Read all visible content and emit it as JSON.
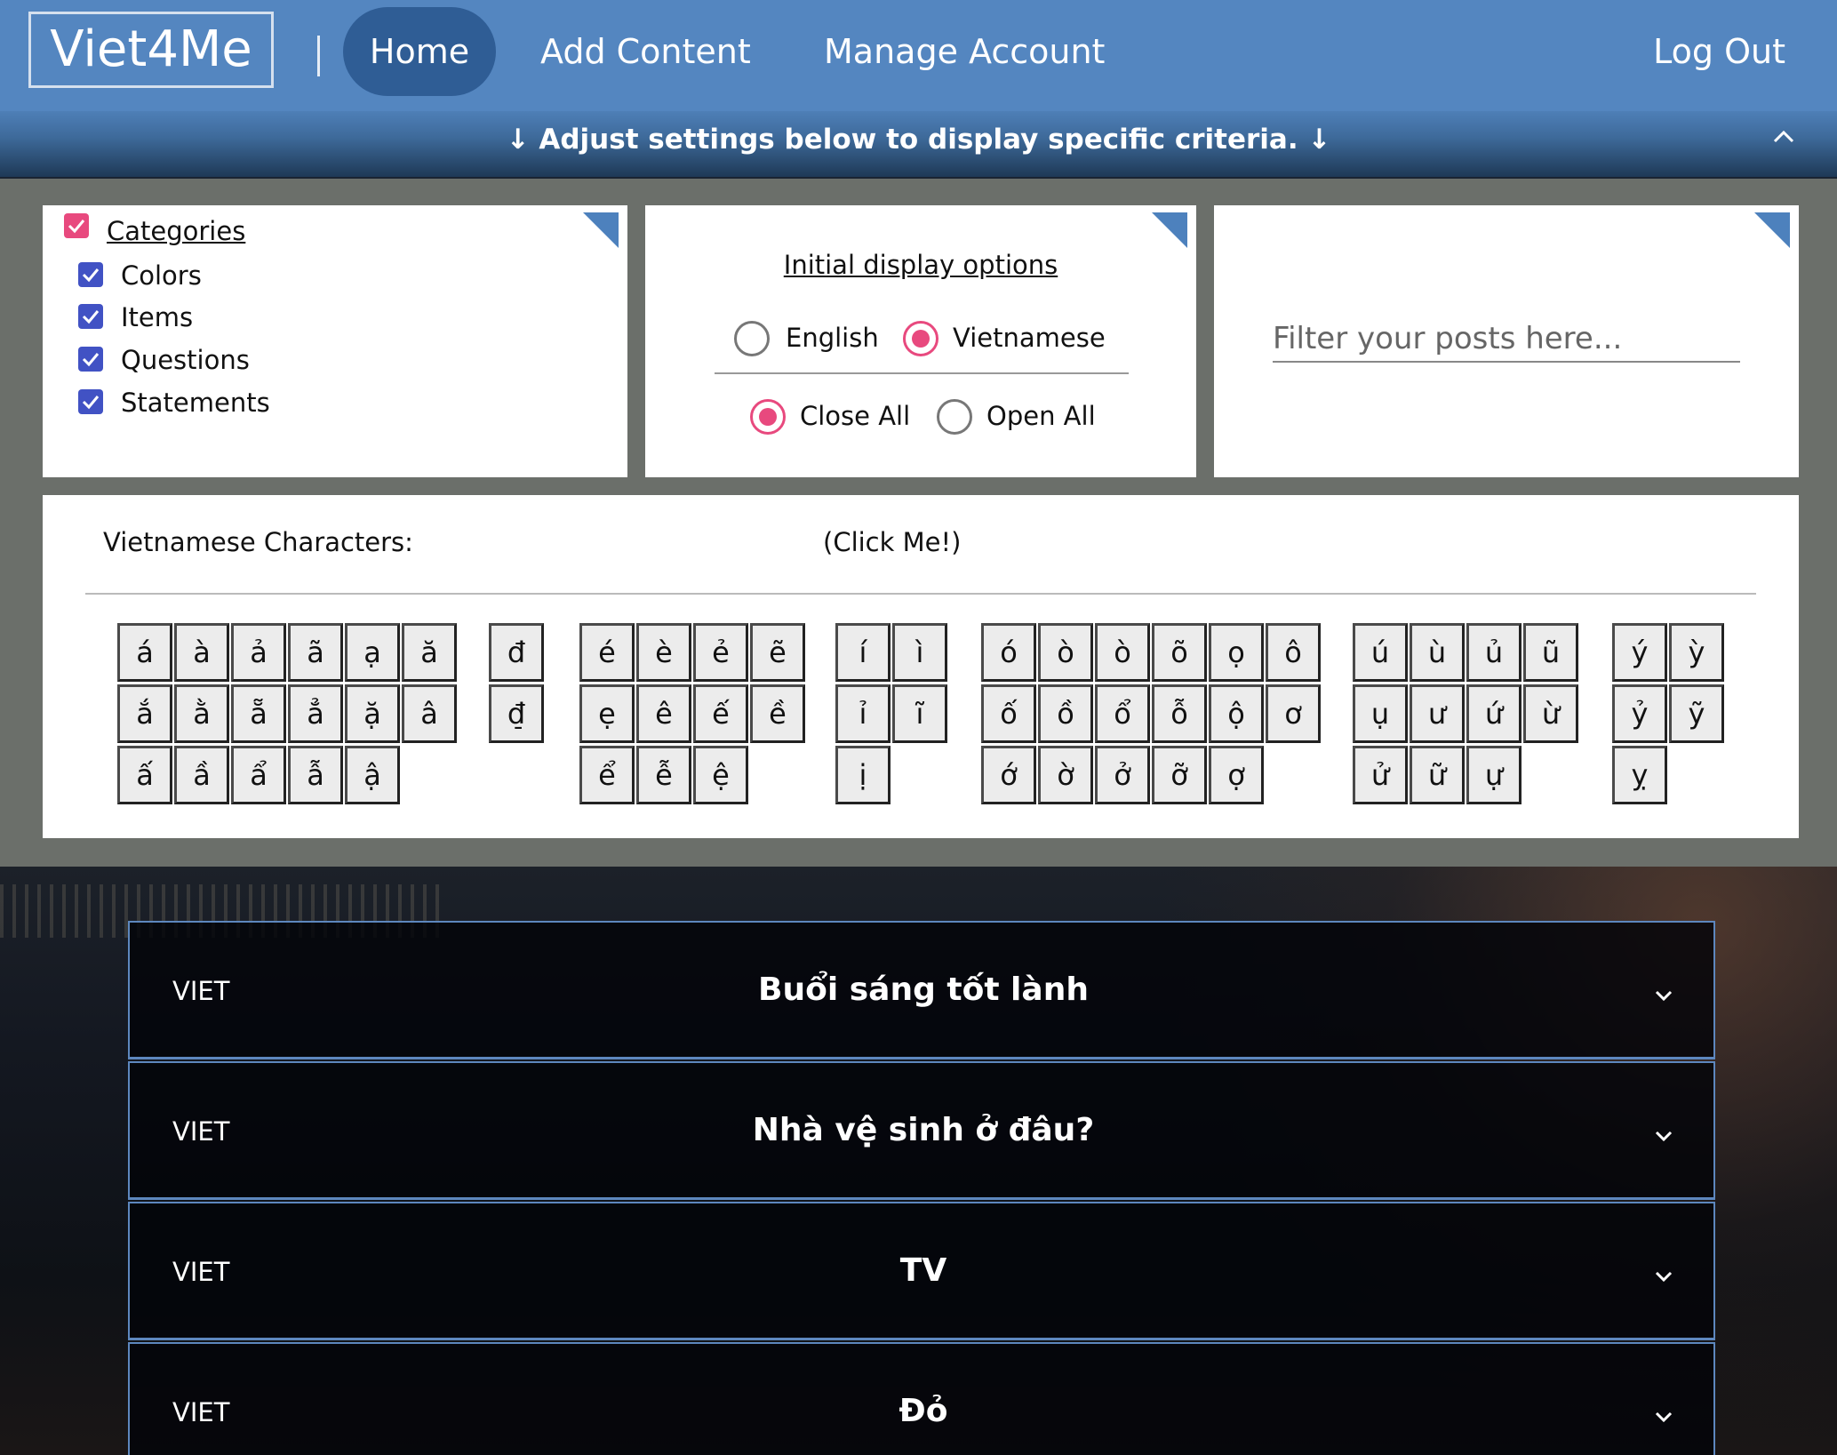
{
  "nav": {
    "brand": "Viet4Me",
    "home": "Home",
    "add_content": "Add Content",
    "manage_account": "Manage Account",
    "logout": "Log Out"
  },
  "settings_bar": {
    "text": "↓ Adjust settings below to display specific criteria. ↓"
  },
  "categories": {
    "title": "Categories",
    "all_checked": true,
    "items": [
      {
        "label": "Colors",
        "checked": true
      },
      {
        "label": "Items",
        "checked": true
      },
      {
        "label": "Questions",
        "checked": true
      },
      {
        "label": "Statements",
        "checked": true
      }
    ]
  },
  "display_options": {
    "title": "Initial display options",
    "language": [
      {
        "label": "English",
        "selected": false
      },
      {
        "label": "Vietnamese",
        "selected": true
      }
    ],
    "expand": [
      {
        "label": "Close All",
        "selected": true
      },
      {
        "label": "Open All",
        "selected": false
      }
    ]
  },
  "filter": {
    "placeholder": "Filter your posts here..."
  },
  "characters": {
    "title": "Vietnamese Characters:",
    "hint": "(Click Me!)",
    "groups": [
      [
        "á",
        "à",
        "ả",
        "ã",
        "ạ",
        "ă",
        "ắ",
        "ằ",
        "ẵ",
        "ẳ",
        "ặ",
        "â",
        "ấ",
        "ầ",
        "ẩ",
        "ẫ",
        "ậ"
      ],
      [
        "đ",
        "đ̠"
      ],
      [
        "é",
        "è",
        "ẻ",
        "ẽ",
        "ẹ",
        "ê",
        "ế",
        "ề",
        "ể",
        "ễ",
        "ệ"
      ],
      [
        "í",
        "ì",
        "ỉ",
        "ĩ",
        "ị"
      ],
      [
        "ó",
        "ò",
        "ò",
        "õ",
        "ọ",
        "ô",
        "ố",
        "ồ",
        "ổ",
        "ỗ",
        "ộ",
        "ơ",
        "ớ",
        "ờ",
        "ở",
        "ỡ",
        "ợ"
      ],
      [
        "ú",
        "ù",
        "ủ",
        "ũ",
        "ụ",
        "ư",
        "ứ",
        "ừ",
        "ử",
        "ữ",
        "ự"
      ],
      [
        "ý",
        "ỳ",
        "ỷ",
        "ỹ",
        "ỵ"
      ]
    ]
  },
  "posts": [
    {
      "tag": "VIET",
      "title": "Buổi sáng tốt lành"
    },
    {
      "tag": "VIET",
      "title": "Nhà vệ sinh ở đâu?"
    },
    {
      "tag": "VIET",
      "title": "TV"
    },
    {
      "tag": "VIET",
      "title": "Đỏ"
    }
  ],
  "colors": {
    "nav_bg": "#5486c0",
    "home_pill": "#2f5d95",
    "accent_pink": "#e8497e",
    "checkbox_blue": "#4152c4",
    "panel_corner": "#4d81bd",
    "accordion_border": "#5d87be"
  }
}
